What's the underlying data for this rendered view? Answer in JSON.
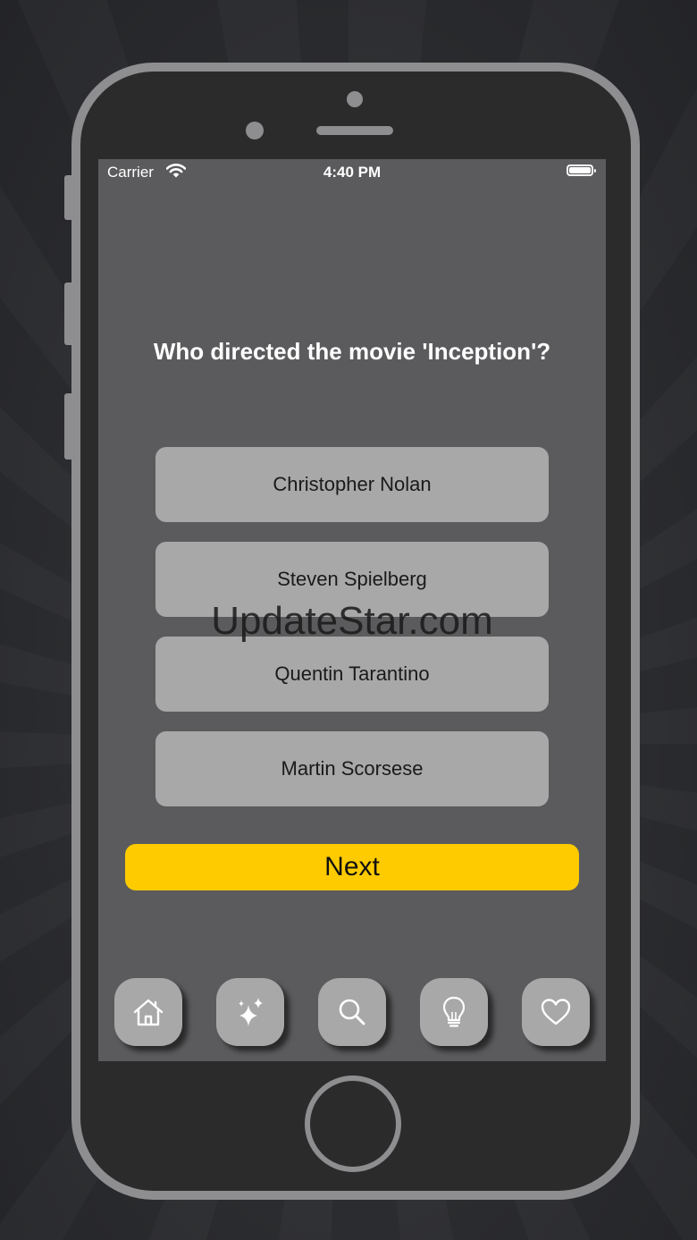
{
  "status_bar": {
    "carrier": "Carrier",
    "time": "4:40 PM",
    "wifi_icon": "wifi-icon",
    "battery_icon": "battery-icon"
  },
  "quiz": {
    "question": "Who directed the movie 'Inception'?",
    "answers": [
      {
        "label": "Christopher Nolan"
      },
      {
        "label": "Steven Spielberg"
      },
      {
        "label": "Quentin Tarantino"
      },
      {
        "label": "Martin Scorsese"
      }
    ],
    "next_label": "Next"
  },
  "watermark": "UpdateStar.com",
  "tab_bar": {
    "items": [
      {
        "icon": "home-icon"
      },
      {
        "icon": "sparkles-icon"
      },
      {
        "icon": "search-icon"
      },
      {
        "icon": "lightbulb-icon"
      },
      {
        "icon": "heart-icon"
      }
    ]
  },
  "colors": {
    "screen_background": "#5b5b5d",
    "answer_button": "#a8a8a9",
    "next_button": "#fecb00",
    "phone_frame": "#8e8e90"
  }
}
